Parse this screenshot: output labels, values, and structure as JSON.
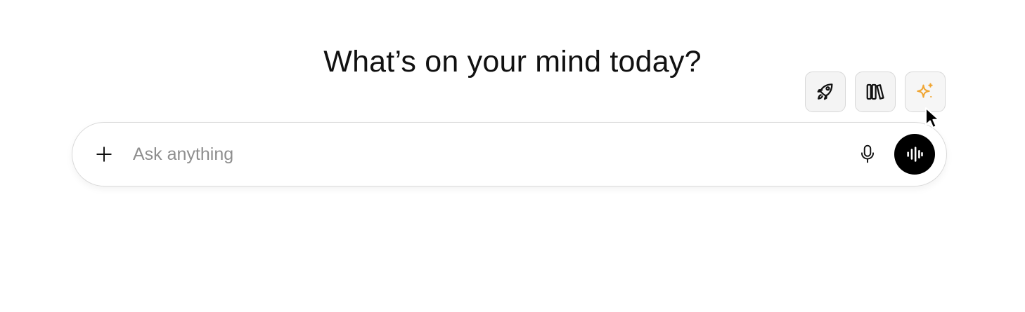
{
  "heading": "What’s on your mind today?",
  "quick_actions": [
    {
      "icon": "rocket-icon"
    },
    {
      "icon": "library-icon"
    },
    {
      "icon": "sparkle-icon",
      "color": "#F0A531"
    }
  ],
  "composer": {
    "placeholder": "Ask anything",
    "value": "",
    "add_icon": "plus-icon",
    "mic_icon": "microphone-icon",
    "voice_icon": "voice-waveform-icon"
  },
  "colors": {
    "accent_sparkle": "#F0A531",
    "voice_button": "#000000",
    "text": "#111111"
  }
}
